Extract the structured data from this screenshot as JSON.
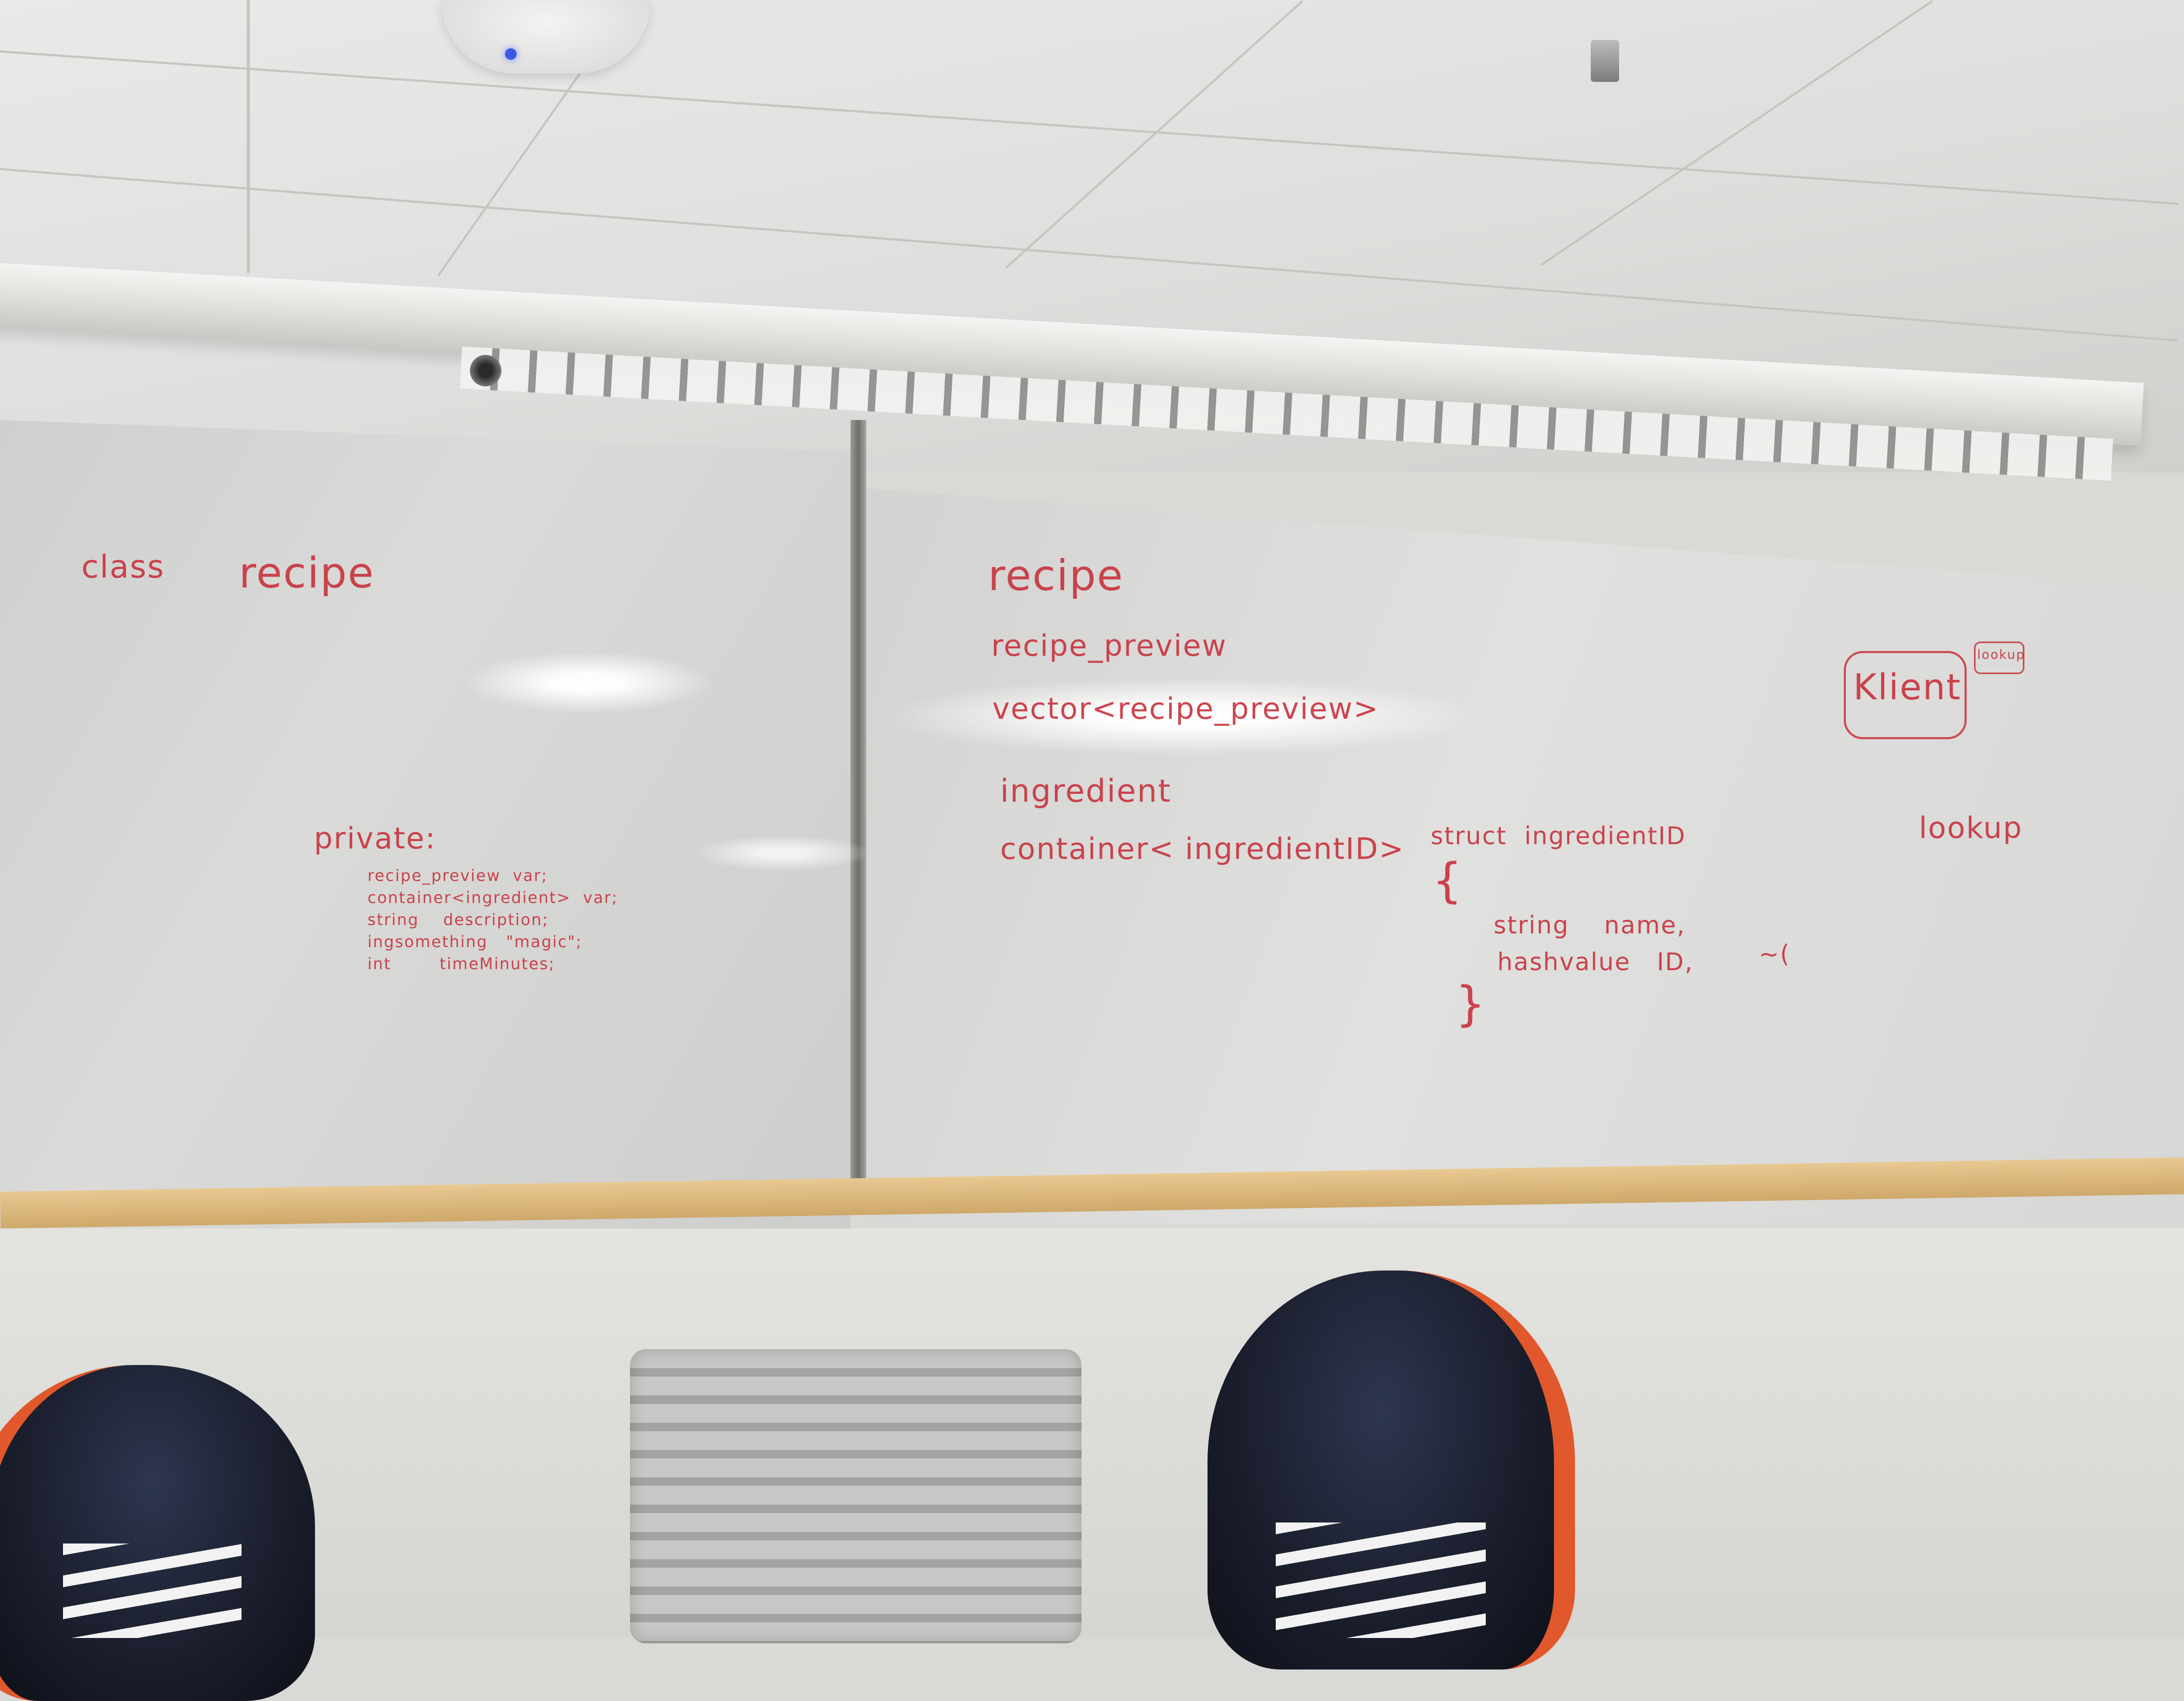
{
  "left_board": {
    "class_keyword": "class",
    "class_name": "recipe",
    "private_label": "private:",
    "members": [
      "recipe_preview  var;",
      "container<ingredient>  var;",
      "string    description;",
      "ingsomething   \"magic\";",
      "int        timeMinutes;"
    ]
  },
  "right_board": {
    "types": [
      "recipe",
      "recipe_preview",
      "vector<recipe_preview>",
      "ingredient",
      "container< ingredientID>"
    ],
    "struct_header": "struct  ingredientID",
    "brace_open": "{",
    "struct_fields": [
      "string    name,",
      "hashvalue   ID,"
    ],
    "brace_close": "}",
    "stray_mark": "~(",
    "klient_label": "Klient",
    "klient_tag": "lookup",
    "lookup_label": "lookup"
  },
  "colors": {
    "marker_ink": "#c8323d",
    "whiteboard": "#d8d8d6",
    "tray": "#d9b57a",
    "detector_led": "#3a5ae6",
    "shoe_accent": "#e0582c"
  },
  "icons": [
    "smoke-detector-icon",
    "sprinkler-icon",
    "camera-icon"
  ]
}
